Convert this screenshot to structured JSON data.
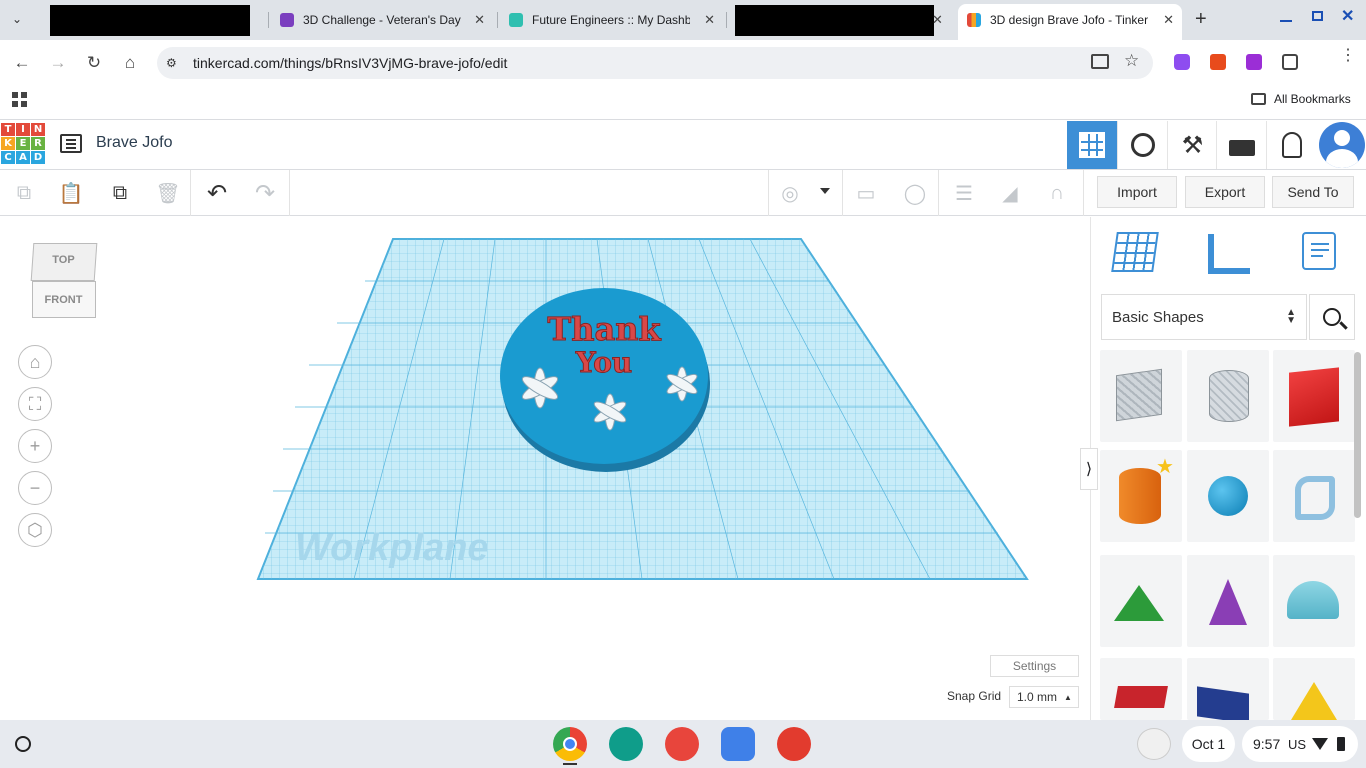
{
  "browser": {
    "tabs": [
      {
        "title": "",
        "redacted": true
      },
      {
        "title": "3D Challenge - Veteran's Day",
        "favicon_color": "#7b3fbf"
      },
      {
        "title": "Future Engineers :: My Dashb",
        "favicon_color": "#2fbfb0"
      },
      {
        "title": "",
        "redacted": true
      },
      {
        "title": "3D design Brave Jofo - Tinker",
        "active": true,
        "favicon_color": "#e34a3a"
      }
    ],
    "new_tab": "+",
    "url": "tinkercad.com/things/bRnsIV3VjMG-brave-jofo/edit",
    "all_bookmarks": "All Bookmarks"
  },
  "app": {
    "logo_letters": [
      "T",
      "I",
      "N",
      "K",
      "E",
      "R",
      "C",
      "A",
      "D"
    ],
    "design_title": "Brave Jofo"
  },
  "toolbar": {
    "import_label": "Import",
    "export_label": "Export",
    "send_to_label": "Send To"
  },
  "viewcube": {
    "top": "TOP",
    "front": "FRONT"
  },
  "workplane": {
    "label": "Workplane"
  },
  "design": {
    "line1": "Thank",
    "line2": "You"
  },
  "bottom": {
    "settings_label": "Settings",
    "snap_grid_label": "Snap Grid",
    "snap_grid_value": "1.0 mm"
  },
  "panel": {
    "category": "Basic Shapes",
    "collapse_label": "⟩",
    "shapes": [
      "box-hole",
      "cylinder-hole",
      "box",
      "cylinder",
      "sphere",
      "scribble",
      "roof",
      "cone",
      "round-roof",
      "text",
      "wedge",
      "pyramid"
    ]
  },
  "taskbar": {
    "date": "Oct 1",
    "time": "9:57",
    "locale": "US"
  }
}
